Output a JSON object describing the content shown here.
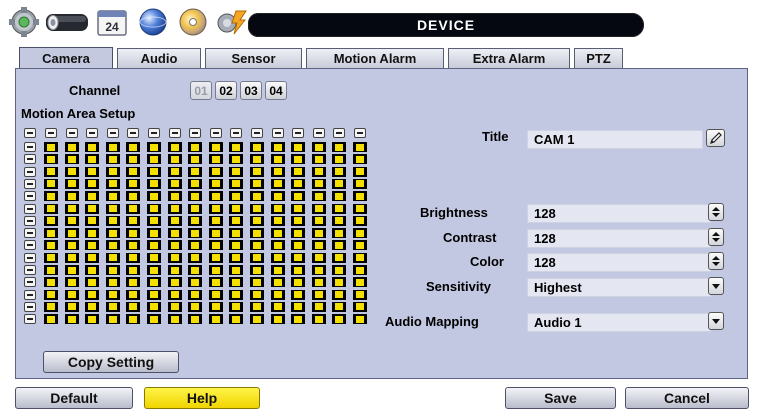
{
  "header": {
    "title": "DEVICE",
    "icons": [
      "gear-icon",
      "camera-icon",
      "calendar-icon",
      "network-icon",
      "disc-icon",
      "tools-icon"
    ],
    "calendar_day": "24"
  },
  "tabs": [
    {
      "label": "Camera",
      "active": true
    },
    {
      "label": "Audio",
      "active": false
    },
    {
      "label": "Sensor",
      "active": false
    },
    {
      "label": "Motion Alarm",
      "active": false
    },
    {
      "label": "Extra Alarm",
      "active": false
    },
    {
      "label": "PTZ",
      "active": false
    }
  ],
  "channel": {
    "label": "Channel",
    "options": [
      {
        "label": "01",
        "enabled": false
      },
      {
        "label": "02",
        "enabled": true
      },
      {
        "label": "03",
        "enabled": true
      },
      {
        "label": "04",
        "enabled": true
      }
    ]
  },
  "motion_area": {
    "label": "Motion Area Setup",
    "columns": 16,
    "rows": 15,
    "all_cells_selected": true,
    "cell_color": "#f4e000"
  },
  "fields": {
    "title": {
      "label": "Title",
      "value": "CAM 1"
    },
    "brightness": {
      "label": "Brightness",
      "value": "128"
    },
    "contrast": {
      "label": "Contrast",
      "value": "128"
    },
    "color": {
      "label": "Color",
      "value": "128"
    },
    "sensitivity": {
      "label": "Sensitivity",
      "value": "Highest"
    },
    "audio_mapping": {
      "label": "Audio Mapping",
      "value": "Audio 1"
    }
  },
  "buttons": {
    "copy_setting": "Copy Setting",
    "default": "Default",
    "help": "Help",
    "save": "Save",
    "cancel": "Cancel"
  },
  "colors": {
    "panel": "#c3c8e2",
    "title_bar": "#050810",
    "help_button": "#f5e20a"
  }
}
